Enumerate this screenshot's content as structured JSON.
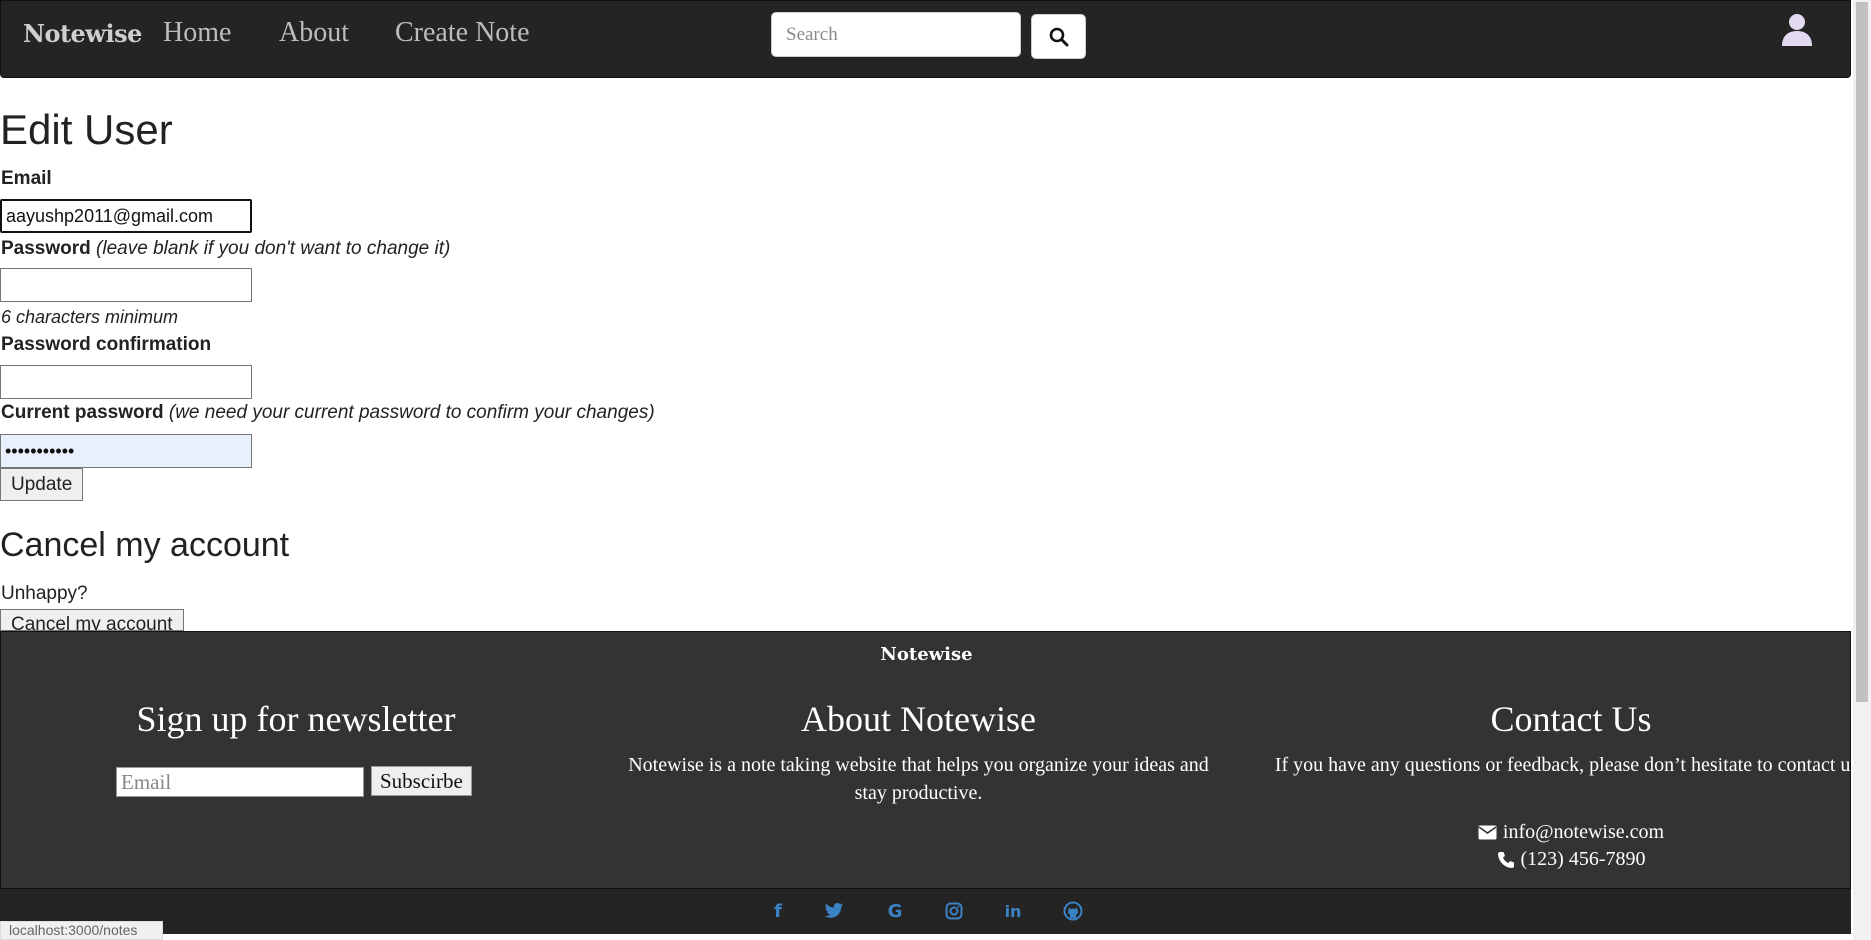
{
  "nav": {
    "brand": "Notewise",
    "links": [
      "Home",
      "About",
      "Create Note"
    ],
    "search_placeholder": "Search"
  },
  "form": {
    "title": "Edit User",
    "email_label": "Email",
    "email_value": "aayushp2011@gmail.com",
    "password_label": "Password",
    "password_note": "(leave blank if you don't want to change it)",
    "password_hint": "6 characters minimum",
    "confirm_label": "Password confirmation",
    "current_label": "Current password",
    "current_note": "(we need your current password to confirm your changes)",
    "current_value": "•••••••••••",
    "update_button": "Update"
  },
  "cancel": {
    "title": "Cancel my account",
    "text": "Unhappy?",
    "button": "Cancel my account"
  },
  "footer": {
    "brand": "Notewise",
    "newsletter_title": "Sign up for newsletter",
    "newsletter_placeholder": "Email",
    "subscribe_button": "Subscirbe",
    "about_title": "About Notewise",
    "about_text": "Notewise is a note taking website that helps you organize your ideas and stay productive.",
    "contact_title": "Contact Us",
    "contact_text": "If you have any questions or feedback, please don’t hesitate to contact us.",
    "email": "info@notewise.com",
    "phone": "(123) 456-7890"
  },
  "social": [
    "facebook-icon",
    "twitter-icon",
    "google-icon",
    "instagram-icon",
    "linkedin-icon",
    "github-icon"
  ],
  "status_url": "localhost:3000/notes",
  "colors": {
    "navbar": "#242424",
    "footer": "#333333",
    "social_icon": "#3b82c4",
    "autofill": "#e8f0fe"
  }
}
